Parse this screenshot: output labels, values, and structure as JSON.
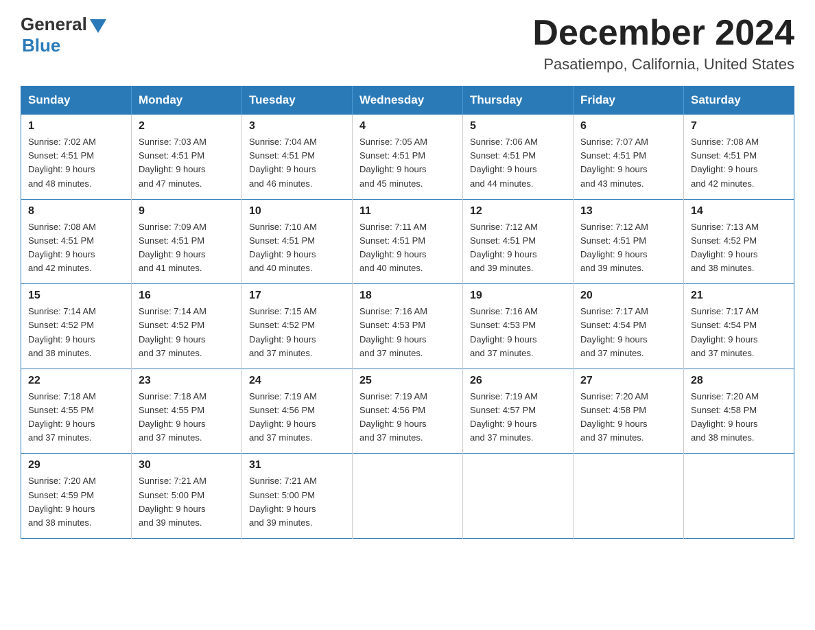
{
  "header": {
    "logo_general": "General",
    "logo_blue": "Blue",
    "month_title": "December 2024",
    "location": "Pasatiempo, California, United States"
  },
  "weekdays": [
    "Sunday",
    "Monday",
    "Tuesday",
    "Wednesday",
    "Thursday",
    "Friday",
    "Saturday"
  ],
  "weeks": [
    [
      {
        "day": "1",
        "sunrise": "7:02 AM",
        "sunset": "4:51 PM",
        "daylight": "9 hours and 48 minutes."
      },
      {
        "day": "2",
        "sunrise": "7:03 AM",
        "sunset": "4:51 PM",
        "daylight": "9 hours and 47 minutes."
      },
      {
        "day": "3",
        "sunrise": "7:04 AM",
        "sunset": "4:51 PM",
        "daylight": "9 hours and 46 minutes."
      },
      {
        "day": "4",
        "sunrise": "7:05 AM",
        "sunset": "4:51 PM",
        "daylight": "9 hours and 45 minutes."
      },
      {
        "day": "5",
        "sunrise": "7:06 AM",
        "sunset": "4:51 PM",
        "daylight": "9 hours and 44 minutes."
      },
      {
        "day": "6",
        "sunrise": "7:07 AM",
        "sunset": "4:51 PM",
        "daylight": "9 hours and 43 minutes."
      },
      {
        "day": "7",
        "sunrise": "7:08 AM",
        "sunset": "4:51 PM",
        "daylight": "9 hours and 42 minutes."
      }
    ],
    [
      {
        "day": "8",
        "sunrise": "7:08 AM",
        "sunset": "4:51 PM",
        "daylight": "9 hours and 42 minutes."
      },
      {
        "day": "9",
        "sunrise": "7:09 AM",
        "sunset": "4:51 PM",
        "daylight": "9 hours and 41 minutes."
      },
      {
        "day": "10",
        "sunrise": "7:10 AM",
        "sunset": "4:51 PM",
        "daylight": "9 hours and 40 minutes."
      },
      {
        "day": "11",
        "sunrise": "7:11 AM",
        "sunset": "4:51 PM",
        "daylight": "9 hours and 40 minutes."
      },
      {
        "day": "12",
        "sunrise": "7:12 AM",
        "sunset": "4:51 PM",
        "daylight": "9 hours and 39 minutes."
      },
      {
        "day": "13",
        "sunrise": "7:12 AM",
        "sunset": "4:51 PM",
        "daylight": "9 hours and 39 minutes."
      },
      {
        "day": "14",
        "sunrise": "7:13 AM",
        "sunset": "4:52 PM",
        "daylight": "9 hours and 38 minutes."
      }
    ],
    [
      {
        "day": "15",
        "sunrise": "7:14 AM",
        "sunset": "4:52 PM",
        "daylight": "9 hours and 38 minutes."
      },
      {
        "day": "16",
        "sunrise": "7:14 AM",
        "sunset": "4:52 PM",
        "daylight": "9 hours and 37 minutes."
      },
      {
        "day": "17",
        "sunrise": "7:15 AM",
        "sunset": "4:52 PM",
        "daylight": "9 hours and 37 minutes."
      },
      {
        "day": "18",
        "sunrise": "7:16 AM",
        "sunset": "4:53 PM",
        "daylight": "9 hours and 37 minutes."
      },
      {
        "day": "19",
        "sunrise": "7:16 AM",
        "sunset": "4:53 PM",
        "daylight": "9 hours and 37 minutes."
      },
      {
        "day": "20",
        "sunrise": "7:17 AM",
        "sunset": "4:54 PM",
        "daylight": "9 hours and 37 minutes."
      },
      {
        "day": "21",
        "sunrise": "7:17 AM",
        "sunset": "4:54 PM",
        "daylight": "9 hours and 37 minutes."
      }
    ],
    [
      {
        "day": "22",
        "sunrise": "7:18 AM",
        "sunset": "4:55 PM",
        "daylight": "9 hours and 37 minutes."
      },
      {
        "day": "23",
        "sunrise": "7:18 AM",
        "sunset": "4:55 PM",
        "daylight": "9 hours and 37 minutes."
      },
      {
        "day": "24",
        "sunrise": "7:19 AM",
        "sunset": "4:56 PM",
        "daylight": "9 hours and 37 minutes."
      },
      {
        "day": "25",
        "sunrise": "7:19 AM",
        "sunset": "4:56 PM",
        "daylight": "9 hours and 37 minutes."
      },
      {
        "day": "26",
        "sunrise": "7:19 AM",
        "sunset": "4:57 PM",
        "daylight": "9 hours and 37 minutes."
      },
      {
        "day": "27",
        "sunrise": "7:20 AM",
        "sunset": "4:58 PM",
        "daylight": "9 hours and 37 minutes."
      },
      {
        "day": "28",
        "sunrise": "7:20 AM",
        "sunset": "4:58 PM",
        "daylight": "9 hours and 38 minutes."
      }
    ],
    [
      {
        "day": "29",
        "sunrise": "7:20 AM",
        "sunset": "4:59 PM",
        "daylight": "9 hours and 38 minutes."
      },
      {
        "day": "30",
        "sunrise": "7:21 AM",
        "sunset": "5:00 PM",
        "daylight": "9 hours and 39 minutes."
      },
      {
        "day": "31",
        "sunrise": "7:21 AM",
        "sunset": "5:00 PM",
        "daylight": "9 hours and 39 minutes."
      },
      null,
      null,
      null,
      null
    ]
  ],
  "labels": {
    "sunrise": "Sunrise:",
    "sunset": "Sunset:",
    "daylight": "Daylight:"
  }
}
